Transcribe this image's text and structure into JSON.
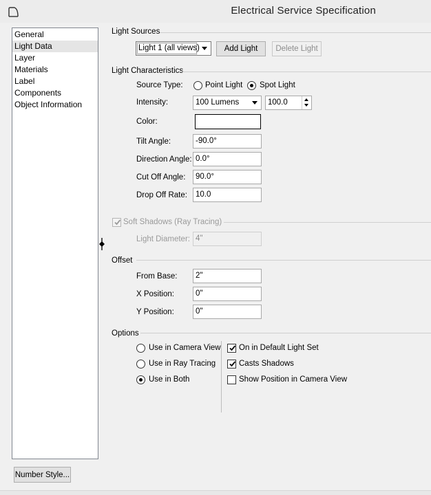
{
  "window": {
    "title": "Electrical Service Specification",
    "app_icon": "arch-icon"
  },
  "nav": {
    "items": [
      "General",
      "Light Data",
      "Layer",
      "Materials",
      "Label",
      "Components",
      "Object Information"
    ],
    "selected": "Light Data"
  },
  "footer": {
    "number_style_label": "Number Style..."
  },
  "light_sources": {
    "label": "Light Sources",
    "selected_light": "Light 1 (all views)",
    "add_label": "Add Light",
    "delete_label": "Delete Light"
  },
  "characteristics": {
    "label": "Light Characteristics",
    "source_type_label": "Source Type:",
    "point_light_label": "Point Light",
    "spot_light_label": "Spot Light",
    "source_type_selected": "Spot Light",
    "intensity_label": "Intensity:",
    "intensity_unit": "100 Lumens",
    "intensity_value": "100.0",
    "color_label": "Color:",
    "color_value": "#ffffff",
    "tilt_label": "Tilt Angle:",
    "tilt_value": "-90.0°",
    "direction_label": "Direction Angle:",
    "direction_value": "0.0°",
    "cutoff_label": "Cut Off Angle:",
    "cutoff_value": "90.0°",
    "dropoff_label": "Drop Off Rate:",
    "dropoff_value": "10.0"
  },
  "soft_shadows": {
    "label": "Soft Shadows (Ray Tracing)",
    "checked": true,
    "diameter_label": "Light Diameter:",
    "diameter_value": "4\""
  },
  "offset": {
    "label": "Offset",
    "from_base_label": "From Base:",
    "from_base_value": "2\"",
    "x_label": "X Position:",
    "x_value": "0\"",
    "y_label": "Y Position:",
    "y_value": "0\""
  },
  "options": {
    "label": "Options",
    "camera_view_label": "Use in Camera View",
    "ray_tracing_label": "Use in Ray Tracing",
    "both_label": "Use in Both",
    "use_selected": "Use in Both",
    "default_set_label": "On in Default Light Set",
    "default_set_checked": true,
    "casts_shadows_label": "Casts Shadows",
    "casts_shadows_checked": true,
    "show_position_label": "Show Position in Camera View",
    "show_position_checked": false
  }
}
